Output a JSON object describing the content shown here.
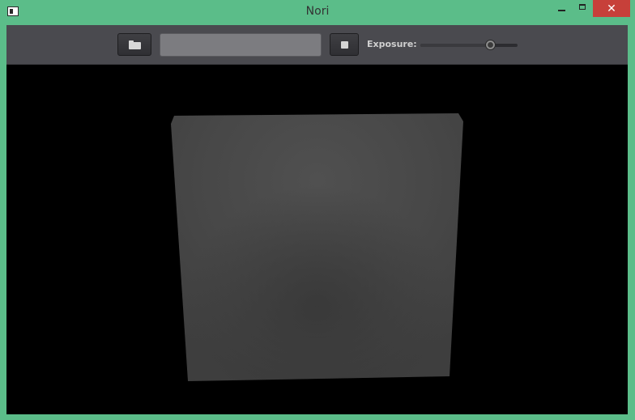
{
  "window": {
    "title": "Nori",
    "controls": {
      "minimize_icon": "minimize-icon",
      "maximize_icon": "maximize-icon",
      "close_icon": "close-icon",
      "close_glyph": "✕"
    },
    "colors": {
      "frame": "#5bbd89",
      "close": "#c7403a"
    }
  },
  "toolbar": {
    "open_icon": "folder-open-icon",
    "filename_value": "",
    "filename_placeholder": "",
    "stop_icon": "stop-icon",
    "exposure_label": "Exposure:",
    "exposure_level": 0.72
  },
  "render": {
    "background": "#000000",
    "surface_color": "#474747",
    "surface_shade": "#3a3a3a"
  }
}
